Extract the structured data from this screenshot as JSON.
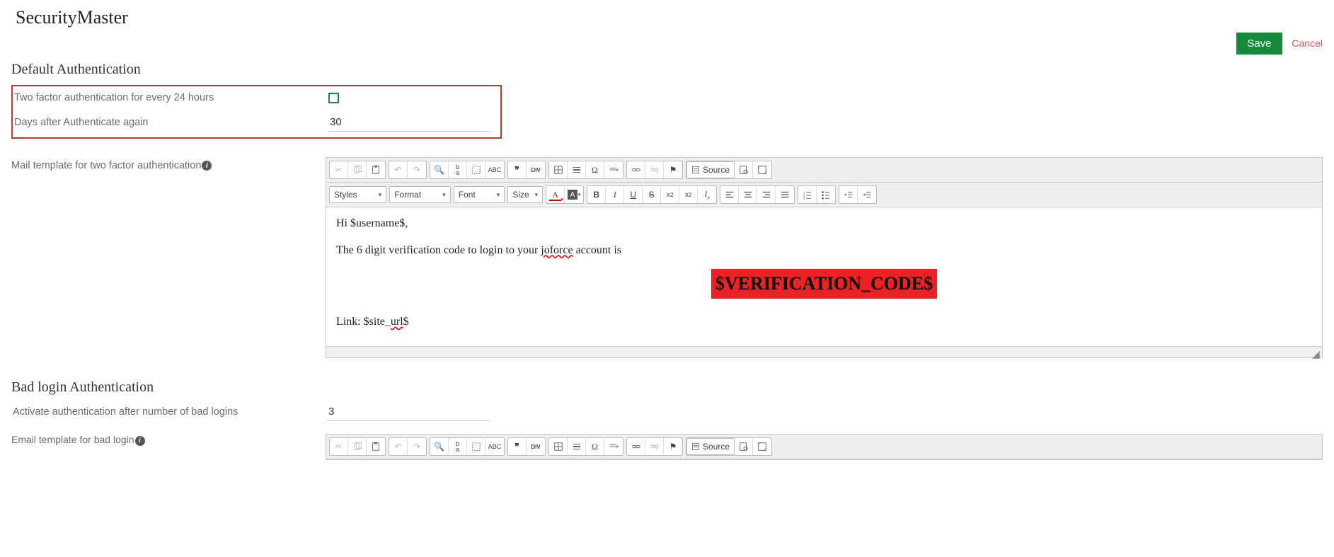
{
  "page": {
    "title": "SecurityMaster",
    "save_label": "Save",
    "cancel_label": "Cancel"
  },
  "sections": {
    "default_auth": {
      "heading": "Default Authentication",
      "tfa_24h_label": "Two factor authentication for every 24 hours",
      "tfa_24h_checked": false,
      "days_label": "Days after Authenticate again",
      "days_value": "30",
      "mail_template_label": "Mail template for two factor authentication"
    },
    "bad_login": {
      "heading": "Bad login Authentication",
      "activate_after_label": "Activate authentication after number of bad logins",
      "activate_after_value": "3",
      "email_template_label": "Email template for bad login"
    }
  },
  "editor": {
    "toolbar": {
      "styles": "Styles",
      "format": "Format",
      "font": "Font",
      "size": "Size",
      "source": "Source"
    },
    "content": {
      "greeting_prefix": "Hi ",
      "greeting_var": "$username$",
      "greeting_suffix": ",",
      "line2_a": "The 6 digit verification code to login to your ",
      "line2_b": "joforce",
      "line2_c": " account is",
      "code": "$VERIFICATION_CODE$",
      "link_prefix": "Link: $site_",
      "link_mid": "url",
      "link_suffix": "$"
    }
  }
}
